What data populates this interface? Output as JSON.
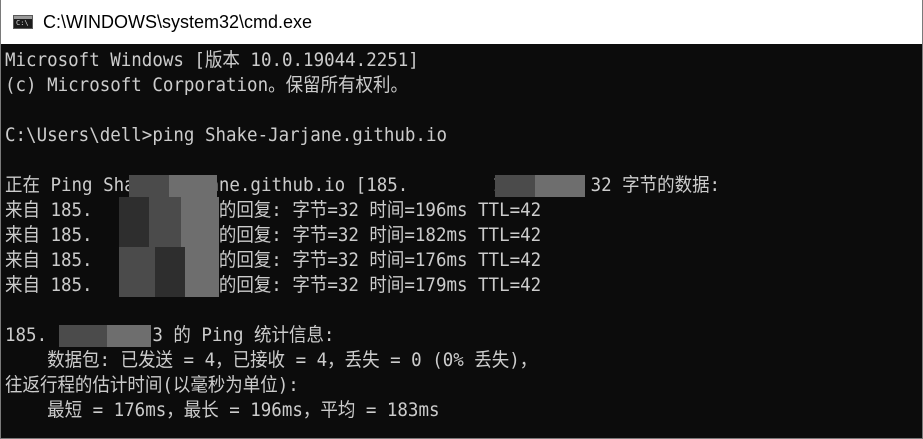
{
  "window": {
    "title": "C:\\WINDOWS\\system32\\cmd.exe",
    "icon_text": "C:\\"
  },
  "console": {
    "lines": [
      "Microsoft Windows [版本 10.0.19044.2251]",
      "(c) Microsoft Corporation。保留所有权利。",
      "",
      "C:\\Users\\dell>ping Shake-Jarjane.github.io",
      "",
      "正在 Ping Shake-Jarjane.github.io [185.        153] 具有 32 字节的数据:",
      "来自 185.       .153 的回复: 字节=32 时间=196ms TTL=42",
      "来自 185.       .153 的回复: 字节=32 时间=182ms TTL=42",
      "来自 185.       .153 的回复: 字节=32 时间=176ms TTL=42",
      "来自 185.       .153 的回复: 字节=32 时间=179ms TTL=42",
      "",
      "185.        153 的 Ping 统计信息:",
      "    数据包: 已发送 = 4，已接收 = 4，丢失 = 0 (0% 丢失)，",
      "往返行程的估计时间(以毫秒为单位):",
      "    最短 = 176ms，最长 = 196ms，平均 = 183ms"
    ]
  },
  "colors": {
    "console_bg": "#0c0c0c",
    "console_fg": "#cccccc",
    "titlebar_bg": "#ffffff"
  }
}
